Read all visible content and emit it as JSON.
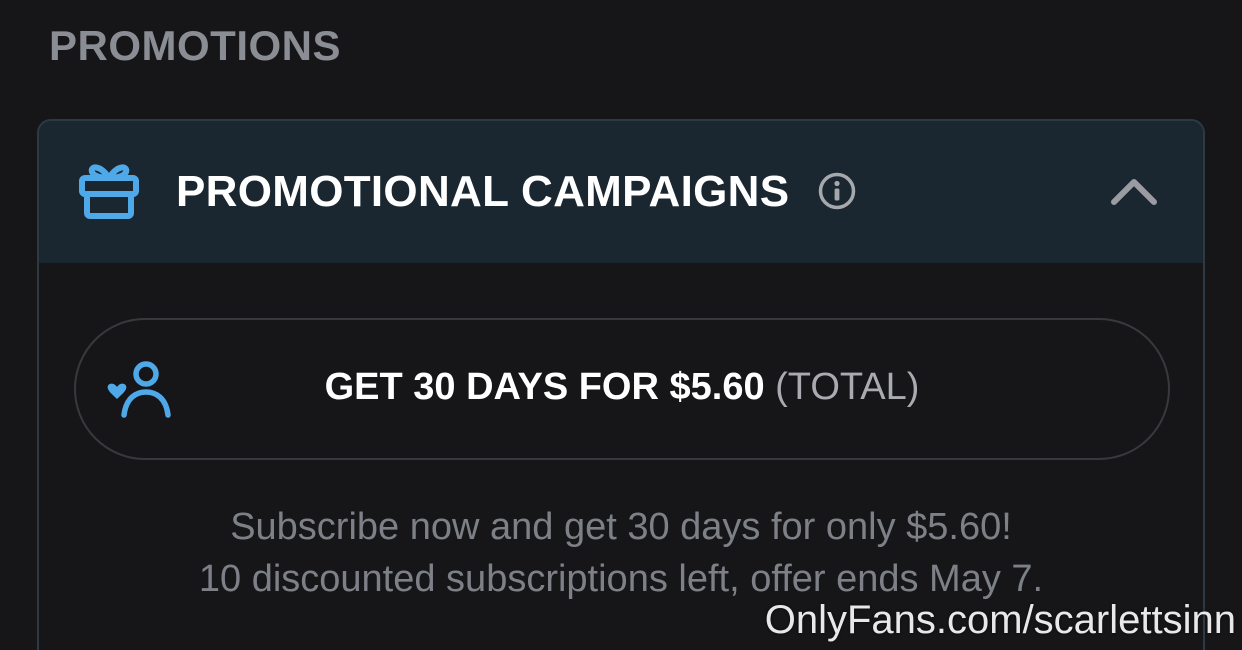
{
  "section": {
    "title": "PROMOTIONS"
  },
  "panel": {
    "icon": "gift-icon",
    "title": "PROMOTIONAL CAMPAIGNS",
    "info_icon": "info-icon",
    "toggle_icon": "chevron-up-icon",
    "expanded": true
  },
  "promo": {
    "icon": "user-heart-icon",
    "main": "GET 30 DAYS FOR $5.60",
    "suffix": "(TOTAL)"
  },
  "description": {
    "line1": "Subscribe now and get 30 days for only $5.60!",
    "line2": "10 discounted subscriptions left, offer ends May 7."
  },
  "watermark": "OnlyFans.com/scarlettsinn",
  "colors": {
    "background": "#161618",
    "header_bg": "#1b2730",
    "accent_blue": "#4fa9e8",
    "muted_text": "#7d8087",
    "title_text": "#8a8d94"
  }
}
